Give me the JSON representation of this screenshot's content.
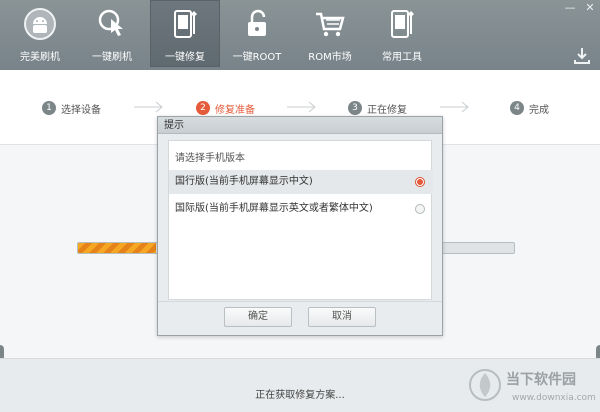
{
  "toolbar": {
    "tools": [
      {
        "label": "完美刷机",
        "icon": "android-logo-icon"
      },
      {
        "label": "一键刷机",
        "icon": "tap-phone-icon"
      },
      {
        "label": "一键修复",
        "icon": "phone-wrench-icon",
        "active": true
      },
      {
        "label": "一键ROOT",
        "icon": "lock-icon"
      },
      {
        "label": "ROM市场",
        "icon": "cart-icon"
      },
      {
        "label": "常用工具",
        "icon": "phone-wrench-icon"
      }
    ]
  },
  "steps": [
    {
      "num": "1",
      "label": "选择设备",
      "state": "done"
    },
    {
      "num": "2",
      "label": "修复准备",
      "state": "current"
    },
    {
      "num": "3",
      "label": "正在修复",
      "state": "pending"
    },
    {
      "num": "4",
      "label": "完成",
      "state": "pending"
    }
  ],
  "progress": {
    "fraction": 0.18
  },
  "status_text": "正在获取修复方案...",
  "dialog": {
    "title": "提示",
    "prompt": "请选择手机版本",
    "options": [
      {
        "label": "国行版(当前手机屏幕显示中文)",
        "selected": true
      },
      {
        "label": "国际版(当前手机屏幕显示英文或者繁体中文)",
        "selected": false
      }
    ],
    "ok_label": "确定",
    "cancel_label": "取消"
  },
  "watermark": {
    "text": "当下软件园",
    "url": "www.downxia.com"
  },
  "colors": {
    "accent": "#e45a3a",
    "toolbar": "#7c868c",
    "progress": "#f5a623"
  }
}
